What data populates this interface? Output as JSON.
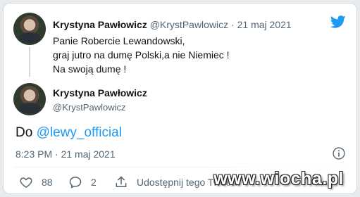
{
  "colors": {
    "accent": "#1d9bf0",
    "muted": "#536471",
    "text": "#0f1419"
  },
  "quoted_tweet": {
    "author_name": "Krystyna Pawłowicz",
    "author_handle": "@KrystPawlowicz",
    "separator": "·",
    "date": "21 maj 2021",
    "lines": [
      "Panie Robercie Lewandowski,",
      "graj jutro na dumę Polski,a nie Niemiec !",
      "Na swoją dumę !"
    ]
  },
  "reply": {
    "author_name": "Krystyna Pawłowicz",
    "author_handle": "@KrystPawlowicz",
    "text_prefix": "Do",
    "mention": "@lewy_official",
    "timestamp": "8:23 PM · 21 maj 2021"
  },
  "actions": {
    "likes": "88",
    "replies": "2",
    "share_label": "Udostępnij tego Tweeta"
  },
  "icons": [
    "twitter-bird-icon",
    "info-icon",
    "heart-icon",
    "reply-bubble-icon",
    "share-icon"
  ],
  "watermark": "www.wiocha.pl"
}
